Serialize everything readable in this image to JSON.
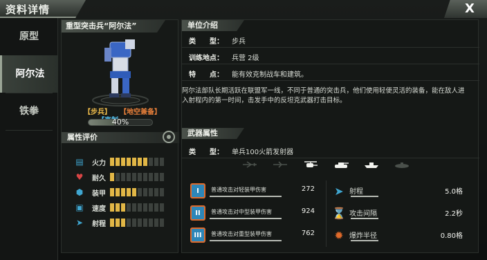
{
  "window": {
    "title": "资料详情",
    "close_label": "X"
  },
  "sidebar": {
    "items": [
      {
        "label": "原型",
        "active": false
      },
      {
        "label": "阿尔法",
        "active": true
      },
      {
        "label": "铁拳",
        "active": false
      }
    ]
  },
  "unit": {
    "name": "重型突击兵“阿尔法”",
    "tags": {
      "infantry": "【步兵】",
      "anti_air": "【地空兼备】",
      "counter": "【克制"
    },
    "progress": {
      "value": 0.4,
      "label": "40%"
    }
  },
  "attributes": {
    "header": "属性评价",
    "rows": [
      {
        "label": "火力",
        "icon": "firepower-icon",
        "level": 7,
        "max": 10
      },
      {
        "label": "耐久",
        "icon": "heart-icon",
        "level": 1,
        "max": 10
      },
      {
        "label": "装甲",
        "icon": "armor-icon",
        "level": 5,
        "max": 10
      },
      {
        "label": "速度",
        "icon": "speed-icon",
        "level": 3,
        "max": 10
      },
      {
        "label": "射程",
        "icon": "range-icon",
        "level": 3,
        "max": 10
      }
    ]
  },
  "unit_intro": {
    "header": "单位介绍",
    "rows": [
      {
        "key": "类　　型：",
        "value": "步兵"
      },
      {
        "key": "训练地点：",
        "value": "兵营 2级"
      },
      {
        "key": "特　　点：",
        "value": "能有效克制战车和建筑。"
      }
    ],
    "description": "阿尔法部队长期活跃在联盟军一线，不同于普通的突击兵，他们使用轻便灵活的装备，能在敌人进入射程内的第一时间，击发手中的反坦克武器打击目标。"
  },
  "weapon": {
    "header": "武器属性",
    "type_key": "类　　型：",
    "type_value": "单兵100火箭发射器",
    "targets": [
      "fighter-jet-icon",
      "jet-icon",
      "helicopter-icon",
      "tank-icon",
      "ship-icon",
      "submarine-icon"
    ],
    "target_active": [
      false,
      false,
      true,
      true,
      true,
      false
    ],
    "stats_left": [
      {
        "icon_label": "I",
        "label": "轻装甲",
        "value": "272"
      },
      {
        "icon_label": "II",
        "label": "中型装甲",
        "value": "924"
      },
      {
        "icon_label": "III",
        "label": "重型装甲",
        "value": "762"
      }
    ],
    "stats_left_prefix": "普通攻击对",
    "stats_left_suffix": "伤害",
    "stats_right": [
      {
        "label": "射程",
        "value": "5.0格"
      },
      {
        "label": "攻击间隔",
        "value": "2.2秒"
      },
      {
        "label": "爆炸半径",
        "value": "0.80格"
      }
    ]
  },
  "colors": {
    "accent_yellow": "#e2b746",
    "panel": "#151816",
    "blue": "#4fb8e4"
  }
}
